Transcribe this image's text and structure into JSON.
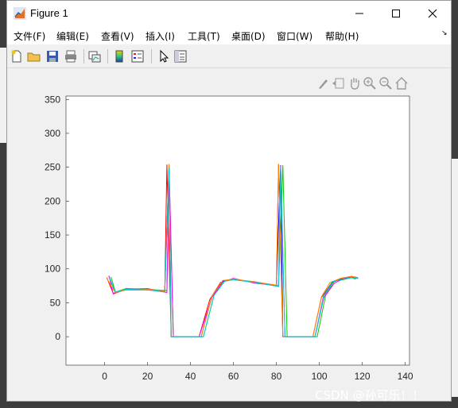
{
  "window": {
    "title": "Figure 1"
  },
  "menu": {
    "items": [
      "文件(F)",
      "编辑(E)",
      "查看(V)",
      "插入(I)",
      "工具(T)",
      "桌面(D)",
      "窗口(W)",
      "帮助(H)"
    ]
  },
  "toolbar": {
    "buttons": [
      "new-figure-icon",
      "open-icon",
      "save-icon",
      "print-icon",
      "link-plot-icon",
      "colorbar-icon",
      "legend-icon",
      "edit-plot-icon",
      "property-inspector-icon"
    ]
  },
  "axes_toolbar": [
    "brush-icon",
    "datatip-icon",
    "pan-icon",
    "zoom-in-icon",
    "zoom-out-icon",
    "home-icon"
  ],
  "watermark": "CSDN @孙可乐！！",
  "chart_data": {
    "type": "line",
    "xlim": [
      -18,
      142
    ],
    "ylim": [
      -42,
      355
    ],
    "xticks": [
      0,
      20,
      40,
      60,
      80,
      100,
      120,
      140
    ],
    "yticks": [
      0,
      50,
      100,
      150,
      200,
      250,
      300,
      350
    ],
    "grid": false,
    "series": [
      {
        "color": "#0000ff",
        "x": [
          2,
          5,
          10,
          20,
          28,
          30,
          31,
          45,
          50,
          55,
          60,
          70,
          80,
          82,
          83,
          98,
          102,
          106,
          110,
          115,
          118
        ],
        "y": [
          89,
          65,
          70,
          70,
          67,
          253,
          0,
          0,
          60,
          82,
          84,
          81,
          75,
          253,
          0,
          0,
          60,
          80,
          85,
          88,
          86
        ]
      },
      {
        "color": "#ff0000",
        "x": [
          1,
          4,
          10,
          20,
          28,
          29,
          31,
          44,
          49,
          54,
          60,
          70,
          80,
          81,
          83,
          97,
          101,
          106,
          110,
          115,
          118
        ],
        "y": [
          87,
          64,
          69,
          69,
          66,
          254,
          0,
          0,
          55,
          80,
          85,
          80,
          76,
          254,
          0,
          0,
          58,
          81,
          86,
          89,
          87
        ]
      },
      {
        "color": "#00cc00",
        "x": [
          3,
          5,
          10,
          20,
          29,
          30,
          32,
          46,
          51,
          56,
          60,
          70,
          81,
          83,
          85,
          99,
          103,
          107,
          111,
          115,
          117
        ],
        "y": [
          88,
          66,
          71,
          70,
          68,
          250,
          0,
          0,
          62,
          83,
          84,
          80,
          74,
          253,
          0,
          0,
          62,
          82,
          84,
          87,
          85
        ]
      },
      {
        "color": "#ff00ff",
        "x": [
          2,
          4,
          10,
          20,
          29,
          30,
          32,
          44,
          50,
          55,
          60,
          70,
          81,
          82,
          84,
          98,
          102,
          107,
          111,
          115,
          118
        ],
        "y": [
          90,
          63,
          70,
          71,
          65,
          252,
          0,
          0,
          58,
          81,
          86,
          79,
          75,
          252,
          0,
          0,
          57,
          79,
          85,
          88,
          86
        ]
      },
      {
        "color": "#ff8800",
        "x": [
          1,
          5,
          10,
          20,
          28,
          30,
          31,
          45,
          50,
          55,
          60,
          70,
          80,
          81,
          83,
          97,
          101,
          105,
          110,
          115,
          118
        ],
        "y": [
          86,
          65,
          69,
          70,
          67,
          255,
          0,
          0,
          60,
          83,
          85,
          81,
          76,
          255,
          0,
          0,
          59,
          80,
          86,
          89,
          87
        ]
      },
      {
        "color": "#00cccc",
        "x": [
          2,
          5,
          10,
          20,
          28,
          30,
          31,
          46,
          51,
          56,
          60,
          70,
          81,
          82,
          84,
          98,
          102,
          106,
          111,
          115,
          118
        ],
        "y": [
          88,
          66,
          70,
          69,
          66,
          250,
          0,
          0,
          61,
          82,
          84,
          80,
          74,
          250,
          0,
          0,
          61,
          81,
          85,
          87,
          86
        ]
      }
    ]
  }
}
